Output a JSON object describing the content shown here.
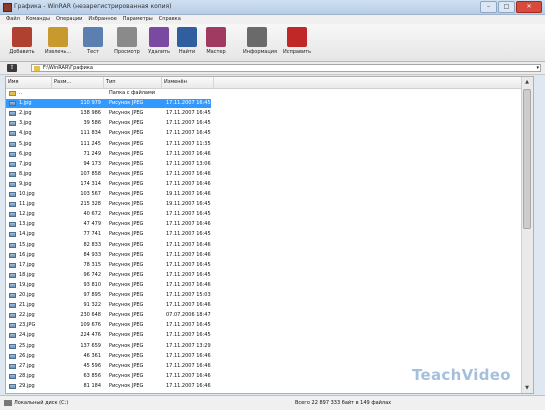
{
  "window": {
    "title": "Графика - WinRAR (незарегистрированная копия)"
  },
  "menu": [
    "Файл",
    "Команды",
    "Операции",
    "Избранное",
    "Параметры",
    "Справка"
  ],
  "toolbar": [
    {
      "label": "Добавить",
      "icon": "add-archive-icon",
      "color": "#b04030"
    },
    {
      "label": "Извлечь...",
      "icon": "extract-icon",
      "color": "#c89a2e"
    },
    {
      "label": "Тест",
      "icon": "test-icon",
      "color": "#5a7fb0"
    },
    {
      "label": "Просмотр",
      "icon": "view-icon",
      "color": "#8a8a8a"
    },
    {
      "label": "Удалить",
      "icon": "delete-icon",
      "color": "#7a4aa0"
    },
    {
      "label": "Найти",
      "icon": "find-icon",
      "color": "#2f5f9f"
    },
    {
      "label": "Мастер",
      "icon": "wizard-icon",
      "color": "#a03a60"
    },
    {
      "label": "Информация",
      "icon": "info-icon",
      "color": "#6a6a6a"
    },
    {
      "label": "Исправить",
      "icon": "repair-icon",
      "color": "#c02828"
    }
  ],
  "address": {
    "path": "F:\\WinRAR\\Графика"
  },
  "columns": {
    "name": "Имя",
    "size": "Разм...",
    "type": "Тип",
    "modified": "Изменён"
  },
  "files": [
    {
      "name": "..",
      "size": "",
      "type": "Папка с файлами",
      "date": ""
    },
    {
      "name": "1.jpg",
      "size": "110 979",
      "type": "Рисунок JPEG",
      "date": "17.11.2007 16:45"
    },
    {
      "name": "2.jpg",
      "size": "138 986",
      "type": "Рисунок JPEG",
      "date": "17.11.2007 16:45"
    },
    {
      "name": "3.jpg",
      "size": "39 586",
      "type": "Рисунок JPEG",
      "date": "17.11.2007 16:45"
    },
    {
      "name": "4.jpg",
      "size": "111 834",
      "type": "Рисунок JPEG",
      "date": "17.11.2007 16:45"
    },
    {
      "name": "5.jpg",
      "size": "111 245",
      "type": "Рисунок JPEG",
      "date": "17.11.2007 11:35"
    },
    {
      "name": "6.jpg",
      "size": "71 249",
      "type": "Рисунок JPEG",
      "date": "17.11.2007 16:46"
    },
    {
      "name": "7.jpg",
      "size": "94 173",
      "type": "Рисунок JPEG",
      "date": "17.11.2007 13:06"
    },
    {
      "name": "8.jpg",
      "size": "107 858",
      "type": "Рисунок JPEG",
      "date": "17.11.2007 16:46"
    },
    {
      "name": "9.jpg",
      "size": "174 314",
      "type": "Рисунок JPEG",
      "date": "17.11.2007 16:46"
    },
    {
      "name": "10.jpg",
      "size": "103 567",
      "type": "Рисунок JPEG",
      "date": "19.11.2007 16:46"
    },
    {
      "name": "11.jpg",
      "size": "215 328",
      "type": "Рисунок JPEG",
      "date": "19.11.2007 16:45"
    },
    {
      "name": "12.jpg",
      "size": "40 672",
      "type": "Рисунок JPEG",
      "date": "17.11.2007 16:45"
    },
    {
      "name": "13.jpg",
      "size": "47 479",
      "type": "Рисунок JPEG",
      "date": "17.11.2007 16:46"
    },
    {
      "name": "14.jpg",
      "size": "77 741",
      "type": "Рисунок JPEG",
      "date": "17.11.2007 16:45"
    },
    {
      "name": "15.jpg",
      "size": "82 833",
      "type": "Рисунок JPEG",
      "date": "17.11.2007 16:46"
    },
    {
      "name": "16.jpg",
      "size": "84 933",
      "type": "Рисунок JPEG",
      "date": "17.11.2007 16:46"
    },
    {
      "name": "17.jpg",
      "size": "78 315",
      "type": "Рисунок JPEG",
      "date": "17.11.2007 16:45"
    },
    {
      "name": "18.jpg",
      "size": "96 742",
      "type": "Рисунок JPEG",
      "date": "17.11.2007 16:45"
    },
    {
      "name": "19.jpg",
      "size": "93 810",
      "type": "Рисунок JPEG",
      "date": "17.11.2007 16:46"
    },
    {
      "name": "20.jpg",
      "size": "97 895",
      "type": "Рисунок JPEG",
      "date": "17.11.2007 15:03"
    },
    {
      "name": "21.jpg",
      "size": "91 322",
      "type": "Рисунок JPEG",
      "date": "17.11.2007 16:46"
    },
    {
      "name": "22.jpg",
      "size": "230 648",
      "type": "Рисунок JPEG",
      "date": "07.07.2006 18:47"
    },
    {
      "name": "23.JPG",
      "size": "109 676",
      "type": "Рисунок JPEG",
      "date": "17.11.2007 16:45"
    },
    {
      "name": "24.jpg",
      "size": "224 476",
      "type": "Рисунок JPEG",
      "date": "17.11.2007 16:45"
    },
    {
      "name": "25.jpg",
      "size": "137 659",
      "type": "Рисунок JPEG",
      "date": "17.11.2007 13:29"
    },
    {
      "name": "26.jpg",
      "size": "46 361",
      "type": "Рисунок JPEG",
      "date": "17.11.2007 16:46"
    },
    {
      "name": "27.jpg",
      "size": "45 596",
      "type": "Рисунок JPEG",
      "date": "17.11.2007 16:46"
    },
    {
      "name": "28.jpg",
      "size": "63 856",
      "type": "Рисунок JPEG",
      "date": "17.11.2007 16:46"
    },
    {
      "name": "29.jpg",
      "size": "81 184",
      "type": "Рисунок JPEG",
      "date": "17.11.2007 16:46"
    }
  ],
  "selected_index": 1,
  "status": {
    "text": "Всего 22 897 333 байт в 149 файлах",
    "drive": "Локальный диск (C:)"
  },
  "watermark": "TeachVideo",
  "colors": {
    "selection": "#3399ff",
    "close_button": "#d84a3b"
  }
}
